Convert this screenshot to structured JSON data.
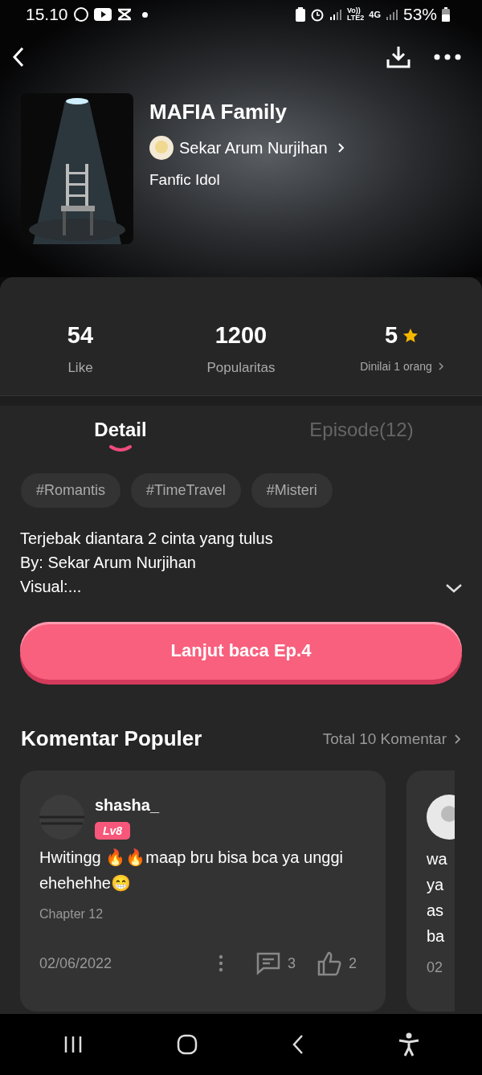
{
  "status_bar": {
    "time": "15.10",
    "volte": "Vo))",
    "lte": "LTE2",
    "network": "4G",
    "battery": "53%"
  },
  "book": {
    "title": "MAFIA Family",
    "author": "Sekar Arum Nurjihan",
    "genre": "Fanfic Idol"
  },
  "stats": [
    {
      "kind": "plain",
      "value": "54",
      "label": "Like"
    },
    {
      "kind": "plain",
      "value": "1200",
      "label": "Popularitas"
    },
    {
      "kind": "rating",
      "value": "5",
      "label": "Dinilai 1 orang"
    }
  ],
  "tabs": [
    {
      "label": "Detail",
      "selected": true
    },
    {
      "label": "Episode(12)",
      "selected": false
    }
  ],
  "tags": [
    "#Romantis",
    "#TimeTravel",
    "#Misteri"
  ],
  "description": [
    "Terjebak diantara 2 cinta yang tulus",
    "By: Sekar Arum Nurjihan",
    "Visual:..."
  ],
  "read_button": "Lanjut baca Ep.4",
  "comments": {
    "title": "Komentar Populer",
    "total": "Total 10 Komentar",
    "items": [
      {
        "user": "shasha_",
        "level": "Lv8",
        "text": "Hwitingg 🔥🔥maap bru bisa bca ya unggi ehehehhe😁",
        "chapter": "Chapter 12",
        "date": "02/06/2022",
        "replies": "3",
        "likes": "2"
      },
      {
        "lines": [
          "wa",
          "ya",
          "as",
          "ba"
        ],
        "date": "02"
      }
    ]
  }
}
